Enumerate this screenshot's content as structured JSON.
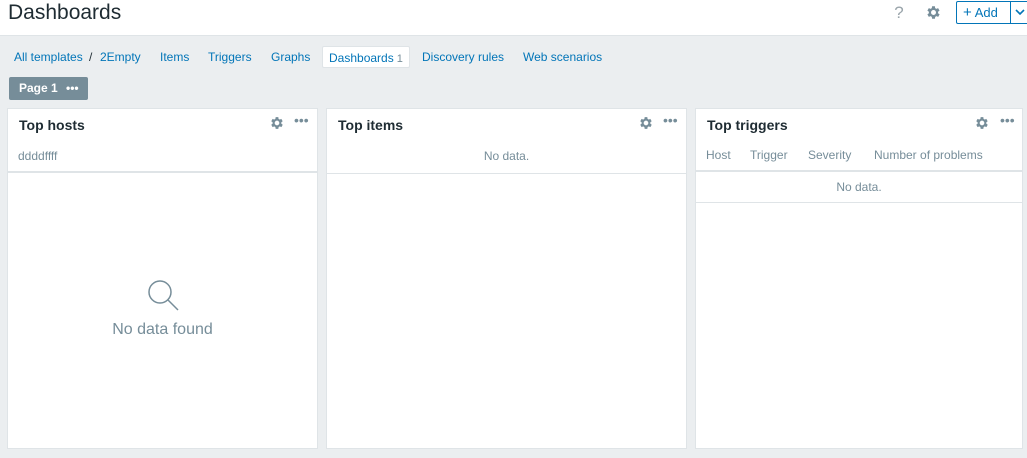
{
  "header": {
    "title": "Dashboards",
    "help_icon": "help-icon",
    "settings_icon": "gear-icon",
    "add_label": "Add"
  },
  "breadcrumbs": {
    "all_templates": "All templates",
    "separator": "/",
    "template": "2Empty",
    "items": "Items",
    "triggers": "Triggers",
    "graphs": "Graphs",
    "dashboards": "Dashboards",
    "dashboards_count": "1",
    "discovery_rules": "Discovery rules",
    "web_scenarios": "Web scenarios"
  },
  "page_tab": {
    "label": "Page 1",
    "menu": "•••"
  },
  "widgets": [
    {
      "title": "Top hosts",
      "subtitle": "ddddffff",
      "empty_text": "No data found",
      "menu": "•••"
    },
    {
      "title": "Top items",
      "empty_text": "No data.",
      "menu": "•••"
    },
    {
      "title": "Top triggers",
      "columns": [
        "Host",
        "Trigger",
        "Severity",
        "Number of problems"
      ],
      "empty_text": "No data.",
      "menu": "•••"
    }
  ],
  "colors": {
    "accent": "#0275b8",
    "muted": "#768d99",
    "background": "#ebeef0",
    "border": "#dfe4e7"
  }
}
